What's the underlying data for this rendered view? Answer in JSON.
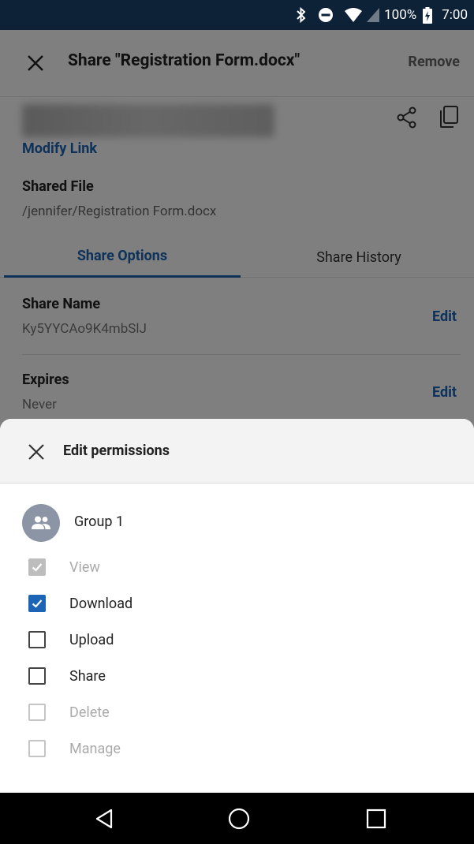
{
  "status_bar": {
    "battery": "100%",
    "time": "7:00",
    "icons": [
      "bluetooth-icon",
      "do-not-disturb-icon",
      "wifi-icon",
      "cell-signal-icon",
      "battery-charging-icon"
    ]
  },
  "header": {
    "title": "Share \"Registration Form.docx\"",
    "remove_label": "Remove"
  },
  "link_section": {
    "modify_link_label": "Modify Link",
    "shared_file_label": "Shared File",
    "shared_file_path": "/jennifer/Registration Form.docx"
  },
  "tabs": [
    {
      "label": "Share Options",
      "active": true
    },
    {
      "label": "Share History",
      "active": false
    }
  ],
  "options": [
    {
      "label": "Share Name",
      "value": "Ky5YYCAo9K4mbSlJ",
      "action": "Edit"
    },
    {
      "label": "Expires",
      "value": "Never",
      "action": "Edit"
    }
  ],
  "sheet": {
    "title": "Edit permissions",
    "group_name": "Group 1",
    "permissions": [
      {
        "label": "View",
        "checked": true,
        "enabled": false
      },
      {
        "label": "Download",
        "checked": true,
        "enabled": true
      },
      {
        "label": "Upload",
        "checked": false,
        "enabled": true
      },
      {
        "label": "Share",
        "checked": false,
        "enabled": true
      },
      {
        "label": "Delete",
        "checked": false,
        "enabled": false
      },
      {
        "label": "Manage",
        "checked": false,
        "enabled": false
      }
    ]
  },
  "colors": {
    "accent": "#1c64b5",
    "status_bar": "#0d2137",
    "avatar": "#8c95a6"
  }
}
